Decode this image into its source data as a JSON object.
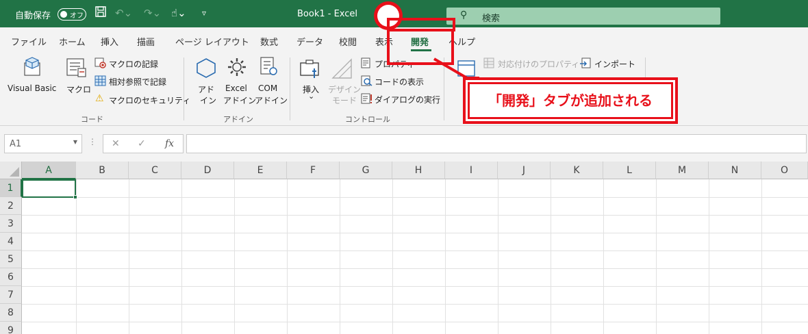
{
  "titlebar": {
    "autosave_label": "自動保存",
    "autosave_toggle": "オフ",
    "doc_title": "Book1  -  Excel",
    "search_placeholder": "検索"
  },
  "tabs": [
    "ファイル",
    "ホーム",
    "挿入",
    "描画",
    "ページ レイアウト",
    "数式",
    "データ",
    "校閲",
    "表示",
    "開発",
    "ヘルプ"
  ],
  "active_tab": "開発",
  "ribbon": {
    "code": {
      "visual_basic": "Visual Basic",
      "macro": "マクロ",
      "record_macro": "マクロの記録",
      "relative_ref": "相対参照で記録",
      "macro_security": "マクロのセキュリティ",
      "group": "コード"
    },
    "addins": {
      "addin_l1": "アド",
      "addin_l2": "イン",
      "excel_l1": "Excel",
      "excel_l2": "アドイン",
      "com_l1": "COM",
      "com_l2": "アドイン",
      "group": "アドイン"
    },
    "controls": {
      "insert": "挿入",
      "insert_caret": "⌄",
      "design_l1": "デザイン",
      "design_l2": "モード",
      "properties": "プロパティ",
      "view_code": "コードの表示",
      "run_dialog": "ダイアログの実行",
      "group": "コントロール"
    },
    "xml": {
      "map_properties": "対応付けのプロパティ",
      "import": "インポート"
    }
  },
  "formula_bar": {
    "name_box": "A1",
    "cancel": "✕",
    "enter": "✓",
    "fx": "fx"
  },
  "sheet": {
    "columns": [
      "A",
      "B",
      "C",
      "D",
      "E",
      "F",
      "G",
      "H",
      "I",
      "J",
      "K",
      "L",
      "M",
      "N",
      "O"
    ],
    "rows": [
      "1",
      "2",
      "3",
      "4",
      "5",
      "6",
      "7",
      "8",
      "9"
    ],
    "selected_cell": "A1"
  },
  "callout": {
    "text": "「開発」タブが追加される",
    "color": "#e8101a"
  },
  "colors": {
    "excel_green": "#217346",
    "ribbon_bg": "#f3f3f3"
  }
}
